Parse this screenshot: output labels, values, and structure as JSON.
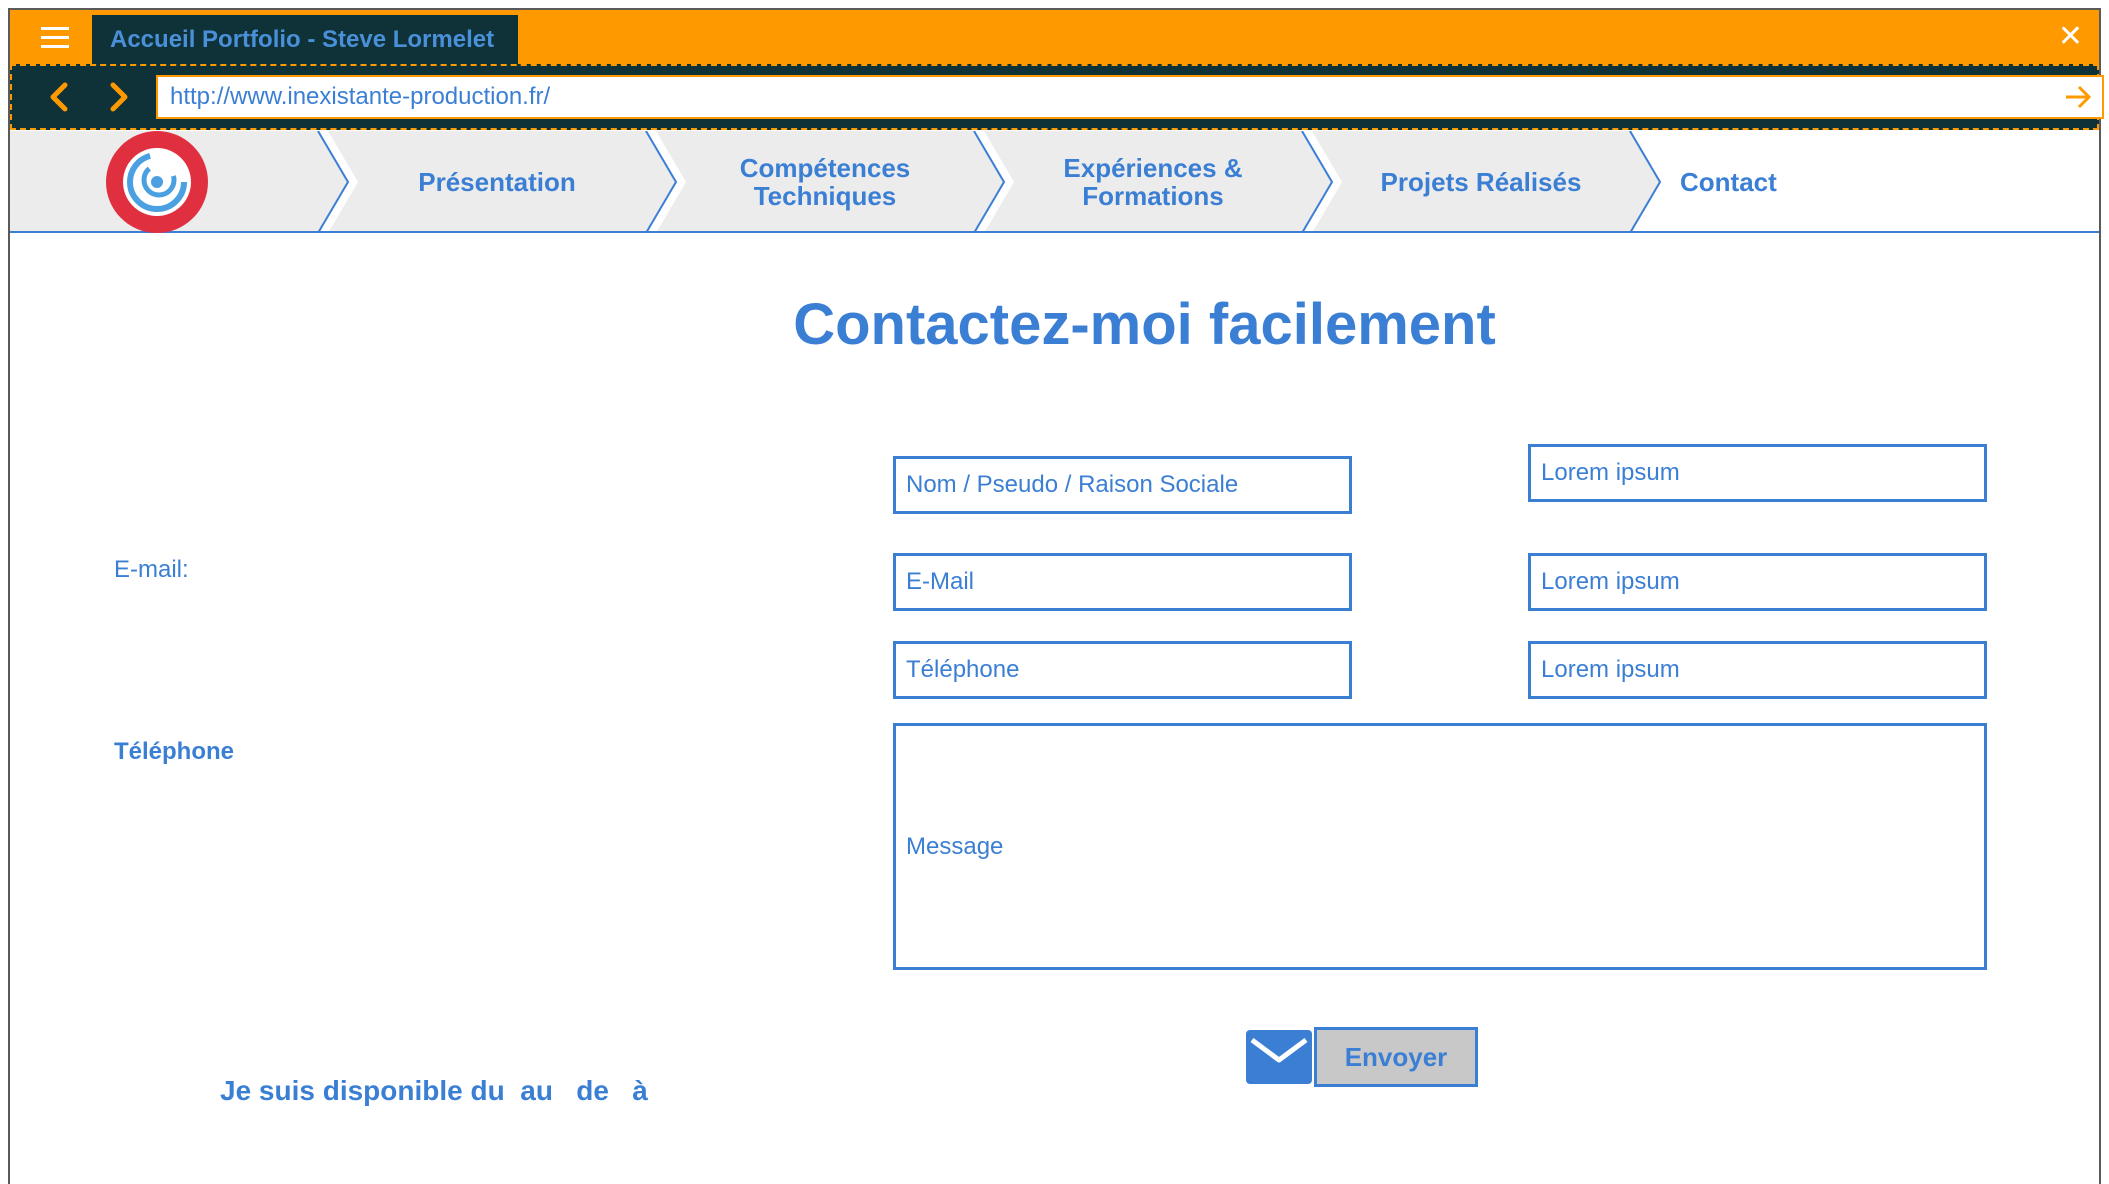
{
  "window": {
    "tab_title": "Accueil Portfolio - Steve Lormelet",
    "url": "http://www.inexistante-production.fr/"
  },
  "nav": {
    "items": [
      {
        "label": "Présentation"
      },
      {
        "label": "Compétences\nTechniques"
      },
      {
        "label": "Expériences &\nFormations"
      },
      {
        "label": "Projets Réalisés"
      },
      {
        "label": "Contact"
      }
    ]
  },
  "page": {
    "title": "Contactez-moi facilement",
    "left_labels": {
      "email": "E-mail:",
      "telephone": "Téléphone"
    },
    "form": {
      "name_placeholder": "Nom / Pseudo / Raison Sociale",
      "email_placeholder": "E-Mail",
      "phone_placeholder": "Téléphone",
      "message_placeholder": "Message",
      "extra_1": "Lorem ipsum",
      "extra_2": "Lorem ipsum",
      "extra_3": "Lorem ipsum",
      "send_label": "Envoyer"
    },
    "availability": "Je suis disponible du  au   de   à"
  },
  "colors": {
    "title_bar": "#ff9900",
    "dark": "#0e3238",
    "accent_blue": "#3b7fd4",
    "logo_red": "#e03040"
  },
  "icons": [
    "menu-icon",
    "close-icon",
    "back-icon",
    "forward-icon",
    "go-arrow-icon",
    "logo-icon",
    "mail-icon"
  ]
}
